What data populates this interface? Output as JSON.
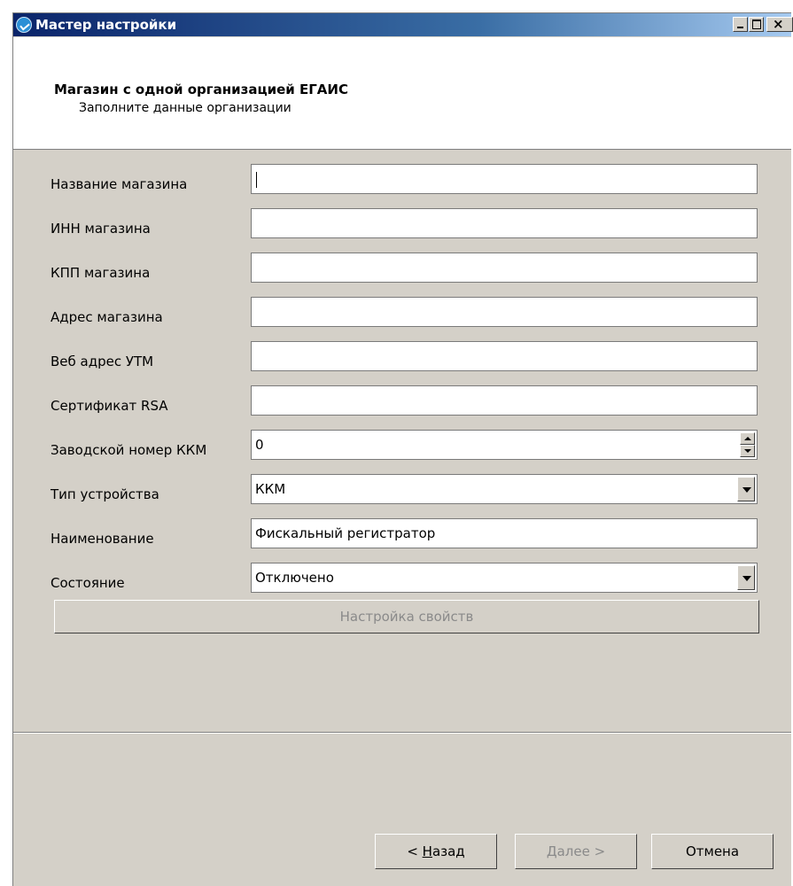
{
  "window": {
    "title": "Мастер настройки"
  },
  "header": {
    "title": "Магазин с одной организацией ЕГАИС",
    "subtitle": "Заполните данные организации"
  },
  "form": {
    "fields": [
      {
        "label": "Название магазина",
        "value": ""
      },
      {
        "label": "ИНН магазина",
        "value": ""
      },
      {
        "label": "КПП магазина",
        "value": ""
      },
      {
        "label": "Адрес магазина",
        "value": ""
      },
      {
        "label": "Веб адрес УТМ",
        "value": ""
      },
      {
        "label": "Сертификат RSA",
        "value": ""
      },
      {
        "label": "Заводской номер ККМ",
        "value": "0"
      },
      {
        "label": "Тип устройства",
        "value": "ККМ"
      },
      {
        "label": "Наименование",
        "value": "Фискальный регистратор"
      },
      {
        "label": "Состояние",
        "value": "Отключено"
      }
    ],
    "properties_button": "Настройка свойств"
  },
  "buttons": {
    "back_prefix": "< ",
    "back_accel": "Н",
    "back_rest": "азад",
    "next_accel": "Д",
    "next_rest": "алее >",
    "cancel": "Отмена"
  }
}
